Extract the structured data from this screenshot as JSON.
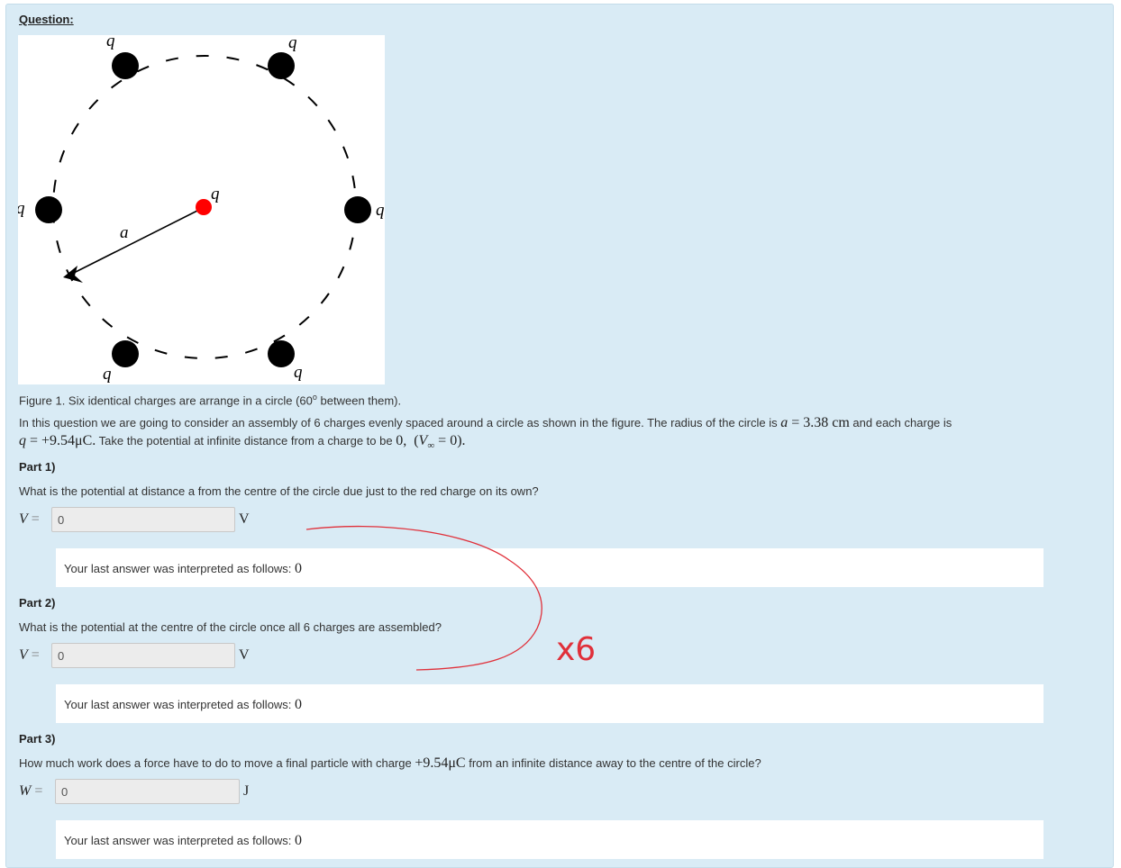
{
  "question": {
    "header": "Question:",
    "figure": {
      "charge_label": "q",
      "radius_label": "a"
    },
    "caption_prefix": "Figure 1. Six identical charges are arrange in a circle (60",
    "caption_degree": "o",
    "caption_suffix": " between them).",
    "intro": {
      "line1_text": "In this question we are going to consider an assembly of 6 charges evenly spaced around a circle as shown in the figure. The radius of the circle is ",
      "radius_var": "a",
      "radius_eq": " = 3.38 cm",
      "line1_end": " and each charge is",
      "charge_var": "q",
      "charge_eq": " = +9.54μC.",
      "line2_text": " Take the potential at infinite distance from a charge to be ",
      "zero_expr": "0,  (V∞ = 0).",
      "v_var": "V",
      "v_sub": "∞",
      "v_eq": " = 0)."
    }
  },
  "parts": [
    {
      "title": "Part 1)",
      "prompt": "What is the potential at distance a from the centre of the circle due just to the red charge on its own?",
      "var": "V",
      "eq": "=",
      "value": "0",
      "unit": "V",
      "feedback_text": "Your last answer was interpreted as follows: ",
      "feedback_value": "0"
    },
    {
      "title": "Part 2)",
      "prompt": "What is the potential at the centre of the circle once all 6 charges are assembled?",
      "var": "V",
      "eq": "=",
      "value": "0",
      "unit": "V",
      "feedback_text": "Your last answer was interpreted as follows: ",
      "feedback_value": "0"
    },
    {
      "title": "Part 3)",
      "prompt_before": "How much work does a force have to do to move a final particle with charge ",
      "prompt_math": "+9.54μC",
      "prompt_after": " from an infinite distance away to the centre of the circle?",
      "var": "W",
      "eq": "=",
      "value": "0",
      "unit": "J",
      "feedback_text": "Your last answer was interpreted as follows: ",
      "feedback_value": "0"
    }
  ],
  "annotation": {
    "handwritten_text": "x6",
    "color": "#e0303a"
  },
  "colors": {
    "panel_bg": "#d9ebf5",
    "red_charge": "#ff0000",
    "charge": "#000000"
  }
}
